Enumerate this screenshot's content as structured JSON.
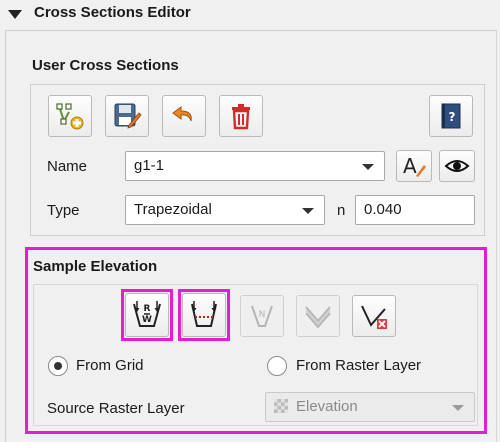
{
  "panel": {
    "title": "Cross Sections Editor"
  },
  "user_cross_sections": {
    "title": "User Cross Sections",
    "toolbar": [
      {
        "icon": "add-cross-section-icon"
      },
      {
        "icon": "save-edit-icon"
      },
      {
        "icon": "undo-icon"
      },
      {
        "icon": "delete-trash-icon"
      },
      {
        "icon": "help-book-icon"
      }
    ],
    "name_label": "Name",
    "name_value": "g1-1",
    "rename_icon": "rename-text-icon",
    "view_icon": "eye-icon",
    "type_label": "Type",
    "type_value": "Trapezoidal",
    "n_label": "n",
    "n_value": "0.040"
  },
  "sample_elevation": {
    "title": "Sample Elevation",
    "toolbar": [
      {
        "icon": "sample-points-icon"
      },
      {
        "icon": "sample-profile-icon"
      },
      {
        "icon": "north-arrow-icon",
        "disabled": true
      },
      {
        "icon": "layered-profile-icon",
        "disabled": true
      },
      {
        "icon": "clear-profile-icon"
      }
    ],
    "from_grid_label": "From Grid",
    "from_raster_label": "From Raster Layer",
    "selected_source": "From Grid",
    "source_raster_label": "Source Raster Layer",
    "source_raster_value": "Elevation",
    "highlight_color": "#e01fd5"
  }
}
